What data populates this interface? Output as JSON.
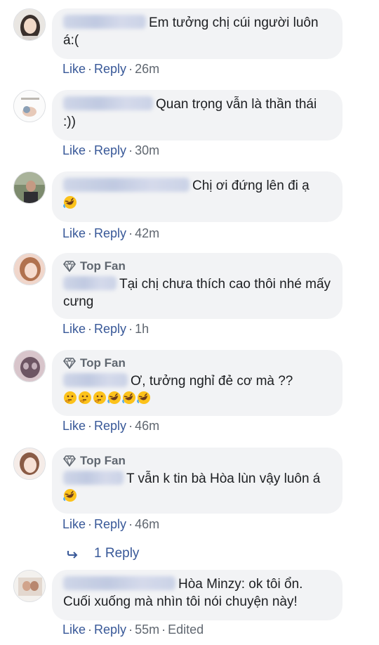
{
  "comments": [
    {
      "text": "Em tưởng chị cúi người luôn á:(",
      "emojis": [],
      "top_fan": false,
      "actions": {
        "like": "Like",
        "reply": "Reply",
        "time": "26m",
        "edited": ""
      }
    },
    {
      "text": "Quan trọng vẫn là thần thái :))",
      "emojis": [],
      "top_fan": false,
      "actions": {
        "like": "Like",
        "reply": "Reply",
        "time": "30m",
        "edited": ""
      }
    },
    {
      "text": "Chị ơi đứng lên đi ạ",
      "emojis": [
        "rofl"
      ],
      "top_fan": false,
      "actions": {
        "like": "Like",
        "reply": "Reply",
        "time": "42m",
        "edited": ""
      }
    },
    {
      "badge": "Top Fan",
      "text": "Tại chị chưa thích cao thôi nhé mấy cưng",
      "emojis": [],
      "top_fan": true,
      "actions": {
        "like": "Like",
        "reply": "Reply",
        "time": "1h",
        "edited": ""
      }
    },
    {
      "badge": "Top Fan",
      "text": "Ơ, tưởng nghỉ đẻ cơ mà ??",
      "emojis": [
        "thinking",
        "thinking",
        "thinking",
        "rofl",
        "rofl",
        "rofl"
      ],
      "top_fan": true,
      "actions": {
        "like": "Like",
        "reply": "Reply",
        "time": "46m",
        "edited": ""
      }
    },
    {
      "badge": "Top Fan",
      "text": "T vẫn k tin bà Hòa lùn vậy luôn á",
      "emojis": [
        "rofl"
      ],
      "top_fan": true,
      "actions": {
        "like": "Like",
        "reply": "Reply",
        "time": "46m",
        "edited": ""
      }
    },
    {
      "text": "Hòa Minzy: ok tôi ổn. Cuối xuống mà nhìn tôi nói chuyện này!",
      "emojis": [],
      "top_fan": false,
      "actions": {
        "like": "Like",
        "reply": "Reply",
        "time": "55m",
        "edited": "Edited"
      }
    }
  ],
  "replies_link": "1 Reply",
  "colors": {
    "link": "#385898",
    "meta": "#606770",
    "bubble": "#f2f3f5",
    "text": "#1c1e21"
  },
  "icons": {
    "badge": "diamond-icon",
    "reply_arrow": "reply-arrow-icon",
    "emoji_rofl": "rofl-emoji-icon",
    "emoji_thinking": "thinking-emoji-icon"
  }
}
